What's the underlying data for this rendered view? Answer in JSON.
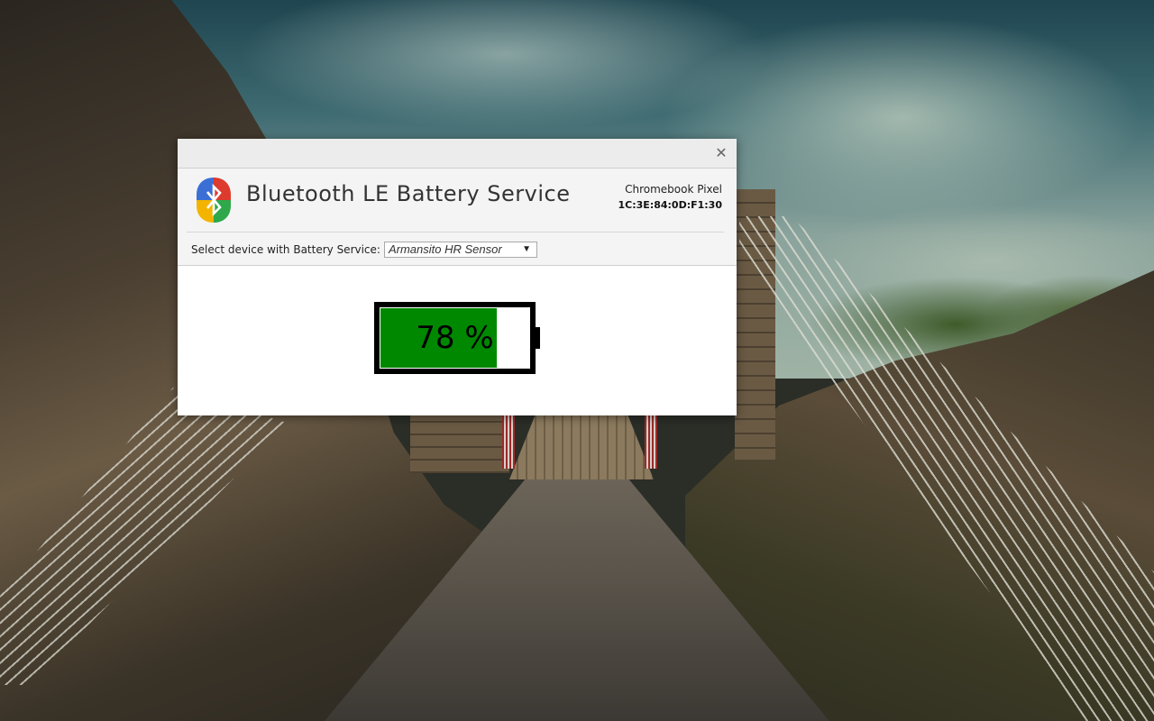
{
  "window": {
    "title": "Bluetooth LE Battery Service",
    "close_glyph": "✕"
  },
  "host": {
    "name": "Chromebook Pixel",
    "address": "1C:3E:84:0D:F1:30"
  },
  "device_select": {
    "label": "Select device with Battery Service:",
    "selected": "Armansito HR Sensor",
    "arrow": "▼"
  },
  "battery": {
    "level_percent": 78,
    "label": "78 %",
    "fill_color": "#008800"
  },
  "icons": {
    "logo": "bluetooth-logo-icon",
    "close": "close-icon",
    "dropdown": "dropdown-arrow-icon"
  }
}
